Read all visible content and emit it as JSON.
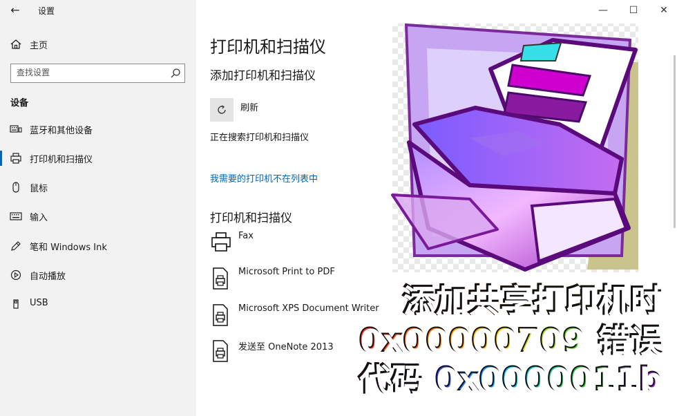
{
  "window": {
    "title": "设置",
    "back_glyph": "←",
    "minimize_glyph": "—",
    "maximize_glyph": "☐",
    "close_glyph": "✕"
  },
  "sidebar": {
    "home_label": "主页",
    "search_placeholder": "查找设置",
    "section_title": "设备",
    "items": [
      {
        "label": "蓝牙和其他设备",
        "icon": "keyboard-icon"
      },
      {
        "label": "打印机和扫描仪",
        "icon": "printer-icon",
        "selected": true
      },
      {
        "label": "鼠标",
        "icon": "mouse-icon"
      },
      {
        "label": "输入",
        "icon": "keyboard-icon"
      },
      {
        "label": "笔和 Windows Ink",
        "icon": "pen-icon"
      },
      {
        "label": "自动播放",
        "icon": "autoplay-icon"
      },
      {
        "label": "USB",
        "icon": "usb-icon"
      }
    ],
    "accent_color": "#0067b8"
  },
  "main": {
    "page_title": "打印机和扫描仪",
    "add_section_title": "添加打印机和扫描仪",
    "refresh_label": "刷新",
    "searching_text": "正在搜索打印机和扫描仪",
    "not_listed_link": "我需要的打印机不在列表中",
    "printers_section_title": "打印机和扫描仪",
    "printers": [
      {
        "name": "Fax",
        "icon": "fax-icon"
      },
      {
        "name": "Microsoft Print to PDF",
        "icon": "document-printer-icon"
      },
      {
        "name": "Microsoft XPS Document Writer",
        "icon": "document-printer-icon"
      },
      {
        "name": "发送至 OneNote 2013",
        "icon": "document-printer-icon"
      }
    ]
  },
  "overlay": {
    "line1": "添加共享打印机时",
    "line2": "0x00000709 错误",
    "line3": "代码 0x0000011b"
  }
}
